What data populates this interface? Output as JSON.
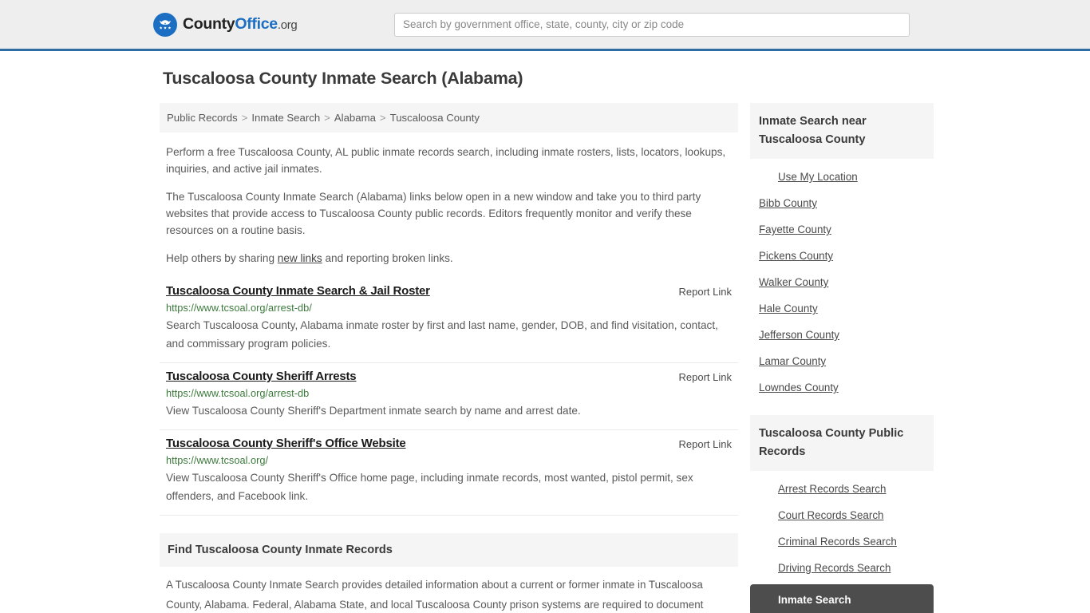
{
  "header": {
    "logo": {
      "icon": "eagle-seal-icon",
      "part1": "County",
      "part2": "Office",
      "tld": ".org",
      "accent_color": "#1b6ec2"
    },
    "search": {
      "placeholder": "Search by government office, state, county, city or zip code",
      "value": ""
    }
  },
  "main": {
    "title": "Tuscaloosa County Inmate Search (Alabama)",
    "breadcrumb": [
      "Public Records",
      "Inmate Search",
      "Alabama",
      "Tuscaloosa County"
    ],
    "breadcrumb_separator": ">",
    "intro": [
      "Perform a free Tuscaloosa County, AL public inmate records search, including inmate rosters, lists, locators, lookups, inquiries, and active jail inmates.",
      "The Tuscaloosa County Inmate Search (Alabama) links below open in a new window and take you to third party websites that provide access to Tuscaloosa County public records. Editors frequently monitor and verify these resources on a routine basis."
    ],
    "help_line": {
      "before": "Help others by sharing ",
      "link": "new links",
      "after": " and reporting broken links."
    },
    "report_link_label": "Report Link",
    "results": [
      {
        "title": "Tuscaloosa County Inmate Search & Jail Roster",
        "url": "https://www.tcsoal.org/arrest-db/",
        "description": "Search Tuscaloosa County, Alabama inmate roster by first and last name, gender, DOB, and find visitation, contact, and commissary program policies."
      },
      {
        "title": "Tuscaloosa County Sheriff Arrests",
        "url": "https://www.tcsoal.org/arrest-db",
        "description": "View Tuscaloosa County Sheriff's Department inmate search by name and arrest date."
      },
      {
        "title": "Tuscaloosa County Sheriff's Office Website",
        "url": "https://www.tcsoal.org/",
        "description": "View Tuscaloosa County Sheriff's Office home page, including inmate records, most wanted, pistol permit, sex offenders, and Facebook link."
      }
    ],
    "bottom_section": {
      "heading": "Find Tuscaloosa County Inmate Records",
      "body": "A Tuscaloosa County Inmate Search provides detailed information about a current or former inmate in Tuscaloosa County, Alabama. Federal, Alabama State, and local Tuscaloosa County prison systems are required to document"
    }
  },
  "sidebar": {
    "nearby": {
      "heading": "Inmate Search near Tuscaloosa County",
      "use_my_location": "Use My Location",
      "counties": [
        "Bibb County",
        "Fayette County",
        "Pickens County",
        "Walker County",
        "Hale County",
        "Jefferson County",
        "Lamar County",
        "Lowndes County"
      ]
    },
    "public_records": {
      "heading": "Tuscaloosa County Public Records",
      "links": [
        "Arrest Records Search",
        "Court Records Search",
        "Criminal Records Search",
        "Driving Records Search"
      ],
      "active_link": "Inmate Search",
      "active_bg": "#4d4d4d"
    }
  }
}
